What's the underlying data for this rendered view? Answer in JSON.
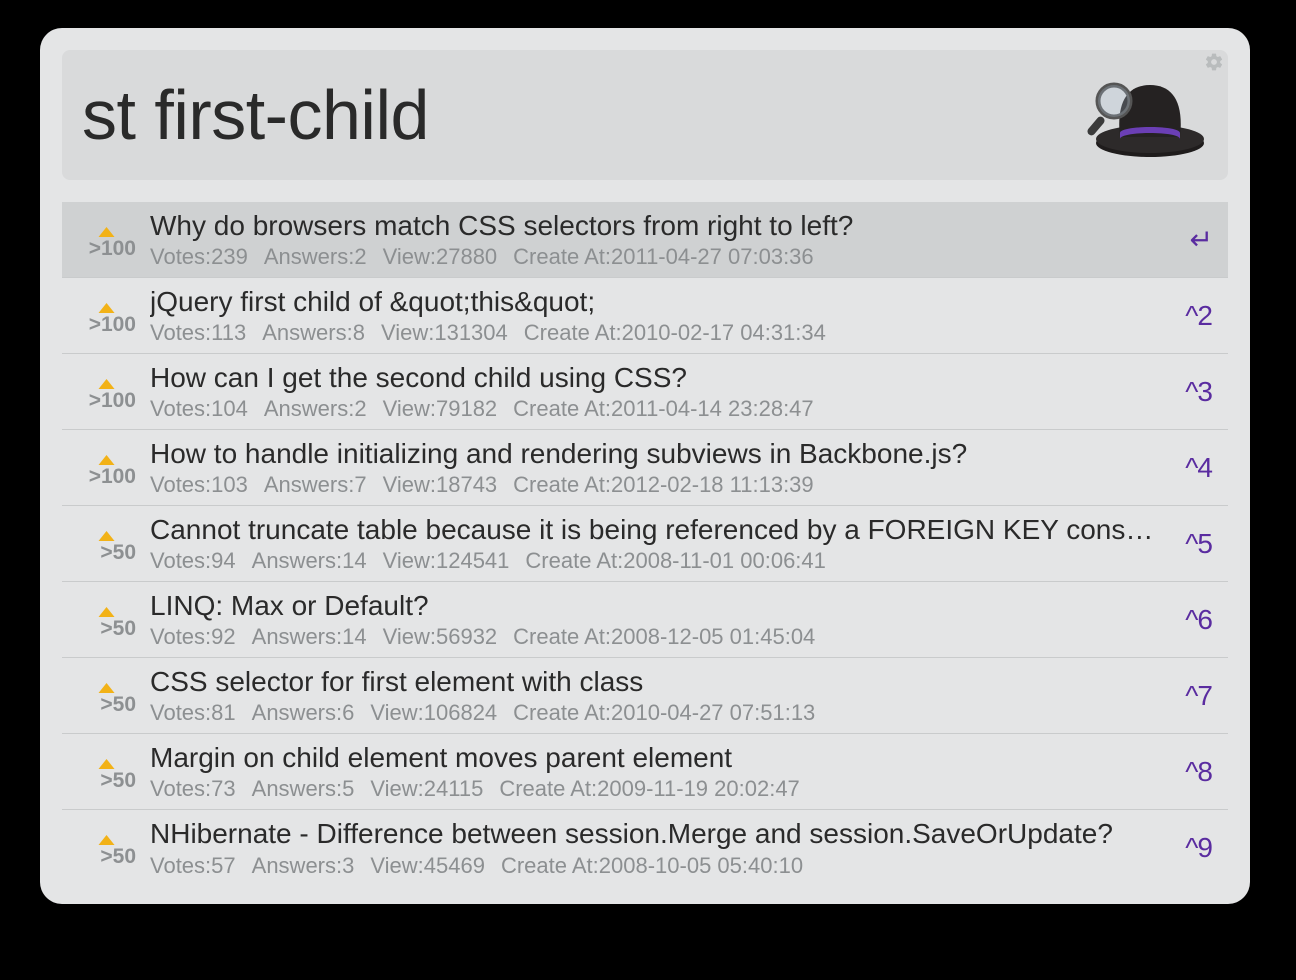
{
  "search": {
    "value": "st first-child"
  },
  "labels": {
    "votes": "Votes",
    "answers": "Answers",
    "view": "View",
    "created": "Create At"
  },
  "results": [
    {
      "badge": ">100",
      "title": "Why do browsers match CSS selectors from right to left?",
      "votes": "239",
      "answers": "2",
      "views": "27880",
      "created": "2011-04-27 07:03:36",
      "shortcut": "↵",
      "selected": true
    },
    {
      "badge": ">100",
      "title": "jQuery first child of &quot;this&quot;",
      "votes": "113",
      "answers": "8",
      "views": "131304",
      "created": "2010-02-17 04:31:34",
      "shortcut": "^2",
      "selected": false
    },
    {
      "badge": ">100",
      "title": "How can I get the second child using CSS?",
      "votes": "104",
      "answers": "2",
      "views": "79182",
      "created": "2011-04-14 23:28:47",
      "shortcut": "^3",
      "selected": false
    },
    {
      "badge": ">100",
      "title": "How to handle initializing and rendering subviews in Backbone.js?",
      "votes": "103",
      "answers": "7",
      "views": "18743",
      "created": "2012-02-18 11:13:39",
      "shortcut": "^4",
      "selected": false
    },
    {
      "badge": ">50",
      "title": "Cannot truncate table because it is being referenced by a FOREIGN KEY constraint?",
      "votes": "94",
      "answers": "14",
      "views": "124541",
      "created": "2008-11-01 00:06:41",
      "shortcut": "^5",
      "selected": false
    },
    {
      "badge": ">50",
      "title": "LINQ: Max or Default?",
      "votes": "92",
      "answers": "14",
      "views": "56932",
      "created": "2008-12-05 01:45:04",
      "shortcut": "^6",
      "selected": false
    },
    {
      "badge": ">50",
      "title": "CSS selector for first element with class",
      "votes": "81",
      "answers": "6",
      "views": "106824",
      "created": "2010-04-27 07:51:13",
      "shortcut": "^7",
      "selected": false
    },
    {
      "badge": ">50",
      "title": "Margin on child element moves parent element",
      "votes": "73",
      "answers": "5",
      "views": "24115",
      "created": "2009-11-19 20:02:47",
      "shortcut": "^8",
      "selected": false
    },
    {
      "badge": ">50",
      "title": "NHibernate - Difference between session.Merge and session.SaveOrUpdate?",
      "votes": "57",
      "answers": "3",
      "views": "45469",
      "created": "2008-10-05 05:40:10",
      "shortcut": "^9",
      "selected": false
    }
  ]
}
